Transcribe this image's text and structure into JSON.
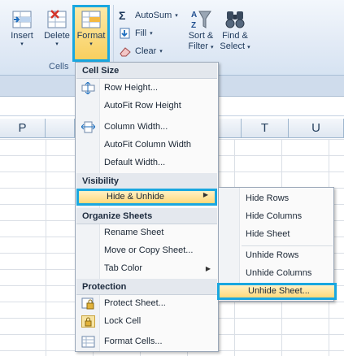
{
  "ribbon": {
    "insert_label": "Insert",
    "delete_label": "Delete",
    "format_label": "Format",
    "cells_group": "Cells",
    "autosum_label": "AutoSum",
    "fill_label": "Fill",
    "clear_label": "Clear",
    "sort_filter_label_1": "Sort &",
    "sort_filter_label_2": "Filter",
    "find_select_label_1": "Find &",
    "find_select_label_2": "Select",
    "dropdown_arrow": "▾"
  },
  "columns": {
    "p": "P",
    "t": "T",
    "u": "U"
  },
  "menu": {
    "cell_size": "Cell Size",
    "row_height": "Row Height...",
    "autofit_row_height": "AutoFit Row Height",
    "column_width": "Column Width...",
    "autofit_column_width": "AutoFit Column Width",
    "default_width": "Default Width...",
    "visibility": "Visibility",
    "hide_unhide": "Hide & Unhide",
    "organize_sheets": "Organize Sheets",
    "rename_sheet": "Rename Sheet",
    "move_copy_sheet": "Move or Copy Sheet...",
    "tab_color": "Tab Color",
    "protection": "Protection",
    "protect_sheet": "Protect Sheet...",
    "lock_cell": "Lock Cell",
    "format_cells": "Format Cells...",
    "submenu_arrow": "▶"
  },
  "submenu": {
    "hide_rows": "Hide Rows",
    "hide_columns": "Hide Columns",
    "hide_sheet": "Hide Sheet",
    "unhide_rows": "Unhide Rows",
    "unhide_columns": "Unhide Columns",
    "unhide_sheet": "Unhide Sheet..."
  },
  "colors": {
    "highlight_border": "#19a7e0",
    "highlight_fill": "#ffd97a"
  }
}
